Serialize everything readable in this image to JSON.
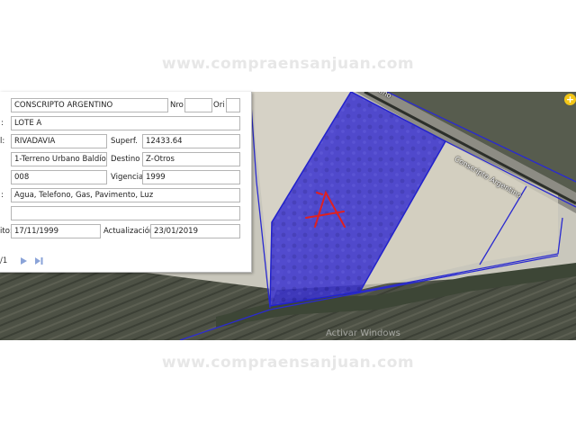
{
  "watermark": "www.compraensanjuan.com",
  "map": {
    "road_labels": [
      "tino",
      "Conscripto Argentino"
    ],
    "add_button": "+",
    "os_watermark": "Activar Windows",
    "colors": {
      "parcel_fill": "#3a33d0",
      "parcel_border": "#2222cc",
      "marker": "#e02020"
    }
  },
  "form": {
    "calle_value": "CONSCRIPTO ARGENTINO",
    "nro_label": "Nro",
    "nro_value": "",
    "ori_label": "Ori",
    "ori_value": "",
    "row2_label": ":",
    "lote_value": "LOTE A",
    "row3_label": "l:",
    "departamento_value": "RIVADAVIA",
    "superf_label": "Superf.",
    "superf_value": "12433.64",
    "tipo_value": "1-Terreno Urbano Baldío",
    "destino_label": "Destino",
    "destino_value": "Z-Otros",
    "codigo_value": "008",
    "vigencia_label": "Vigencia",
    "vigencia_value": "1999",
    "row6_label": ":",
    "servicios_value": "Agua, Telefono, Gas, Pavimento, Luz",
    "observaciones_value": "",
    "fecha_label": "ito:",
    "fecha_value": "17/11/1999",
    "actualizacion_label": "Actualización",
    "actualizacion_value": "23/01/2019"
  },
  "pager": {
    "count": "/1"
  }
}
